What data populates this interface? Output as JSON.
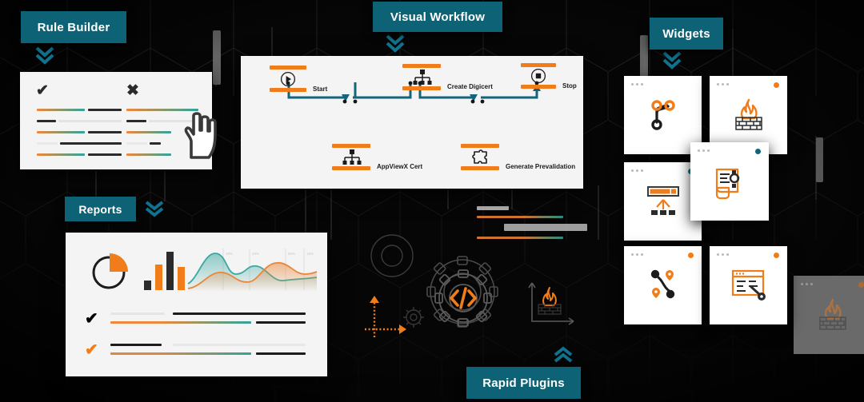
{
  "meta": {
    "background": "#050505",
    "accent_teal": "#0d6275",
    "accent_orange": "#f07d1a",
    "accent_dark": "#1c1c1c",
    "wire_teal": "#14647c",
    "panel_bg": "#f4f4f4",
    "card_bg": "#ffffff"
  },
  "labels": {
    "rule_builder": "Rule Builder",
    "visual_workflow": "Visual Workflow",
    "widgets": "Widgets",
    "reports": "Reports",
    "rapid_plugins": "Rapid Plugins"
  },
  "rule_builder": {
    "columns": [
      {
        "mark": "✔",
        "mark_name": "check-icon"
      },
      {
        "mark": "✖",
        "mark_name": "cross-icon"
      }
    ],
    "cursor_icon": "pointing-hand-cursor"
  },
  "workflow": {
    "nodes": [
      {
        "id": "start",
        "label": "Start",
        "icon": "play-circle-icon"
      },
      {
        "id": "digicert",
        "label": "Create Digicert",
        "icon": "hierarchy-icon"
      },
      {
        "id": "stop",
        "label": "Stop",
        "icon": "stop-circle-icon"
      },
      {
        "id": "appviewx",
        "label": "AppViewX Cert",
        "icon": "hierarchy-icon"
      },
      {
        "id": "prevalid",
        "label": "Generate Prevalidation",
        "icon": "puzzle-piece-icon"
      }
    ]
  },
  "widgets": {
    "cards": [
      {
        "id": "w1",
        "icon": "branch-merge-icon",
        "status_color": "none"
      },
      {
        "id": "w2",
        "icon": "firewall-flame-icon",
        "status_color": "#f07d1a"
      },
      {
        "id": "w3",
        "icon": "progress-upload-icon",
        "status_color": "#137f8c"
      },
      {
        "id": "w4",
        "icon": "certificate-doc-icon",
        "status_color": "#10657a"
      },
      {
        "id": "w5",
        "icon": "branch-nodes-icon",
        "status_color": "#f07d1a"
      },
      {
        "id": "w6",
        "icon": "browser-key-icon",
        "status_color": "#f07d1a"
      },
      {
        "id": "w7",
        "icon": "firewall-flame-icon",
        "status_color": "#b06a2c",
        "dimmed": true
      }
    ]
  },
  "reports": {
    "visuals": [
      {
        "name": "pie-chart-icon",
        "type": "pie"
      },
      {
        "name": "bar-chart-icon",
        "type": "bar"
      },
      {
        "name": "area-chart-icon",
        "type": "area"
      }
    ],
    "rows": [
      {
        "mark": "✔",
        "mark_name": "check-icon-dark",
        "mark_color": "#1c1c1c"
      },
      {
        "mark": "✔",
        "mark_name": "check-icon-orange",
        "mark_color": "#f07d1a"
      }
    ]
  },
  "plugins": {
    "icons": [
      {
        "name": "code-gear-icon"
      },
      {
        "name": "axes-arrows-icon"
      },
      {
        "name": "flame-graph-icon"
      },
      {
        "name": "gear-outline-icon"
      }
    ]
  },
  "chart_data": {
    "type": "area",
    "title": "",
    "xlabel": "",
    "ylabel": "",
    "grid": true,
    "legend_position": "none",
    "x": [
      0,
      1,
      2,
      3,
      4,
      5,
      6,
      7,
      8,
      9,
      10,
      11,
      12
    ],
    "series": [
      {
        "name": "teal",
        "color": "#3aa8a0",
        "values": [
          18,
          52,
          72,
          58,
          36,
          48,
          44,
          30,
          20,
          26,
          30,
          28,
          26
        ]
      },
      {
        "name": "orange",
        "color": "#e8873c",
        "values": [
          8,
          16,
          28,
          36,
          30,
          24,
          34,
          56,
          62,
          52,
          38,
          40,
          42
        ]
      }
    ],
    "tick_labels": [
      "28%",
      "20%",
      "50%",
      "18%"
    ],
    "ylim": [
      0,
      80
    ],
    "secondary": {
      "type": "pie",
      "slices": [
        {
          "label": "",
          "value": 28,
          "color": "#f07d1a"
        },
        {
          "label": "",
          "value": 72,
          "color": "#1c1c1c"
        }
      ]
    },
    "bars": {
      "type": "bar",
      "values": [
        14,
        52,
        78,
        46
      ],
      "colors": [
        "#2b2b2b",
        "#f07d1a",
        "#2b2b2b",
        "#f07d1a"
      ]
    }
  }
}
